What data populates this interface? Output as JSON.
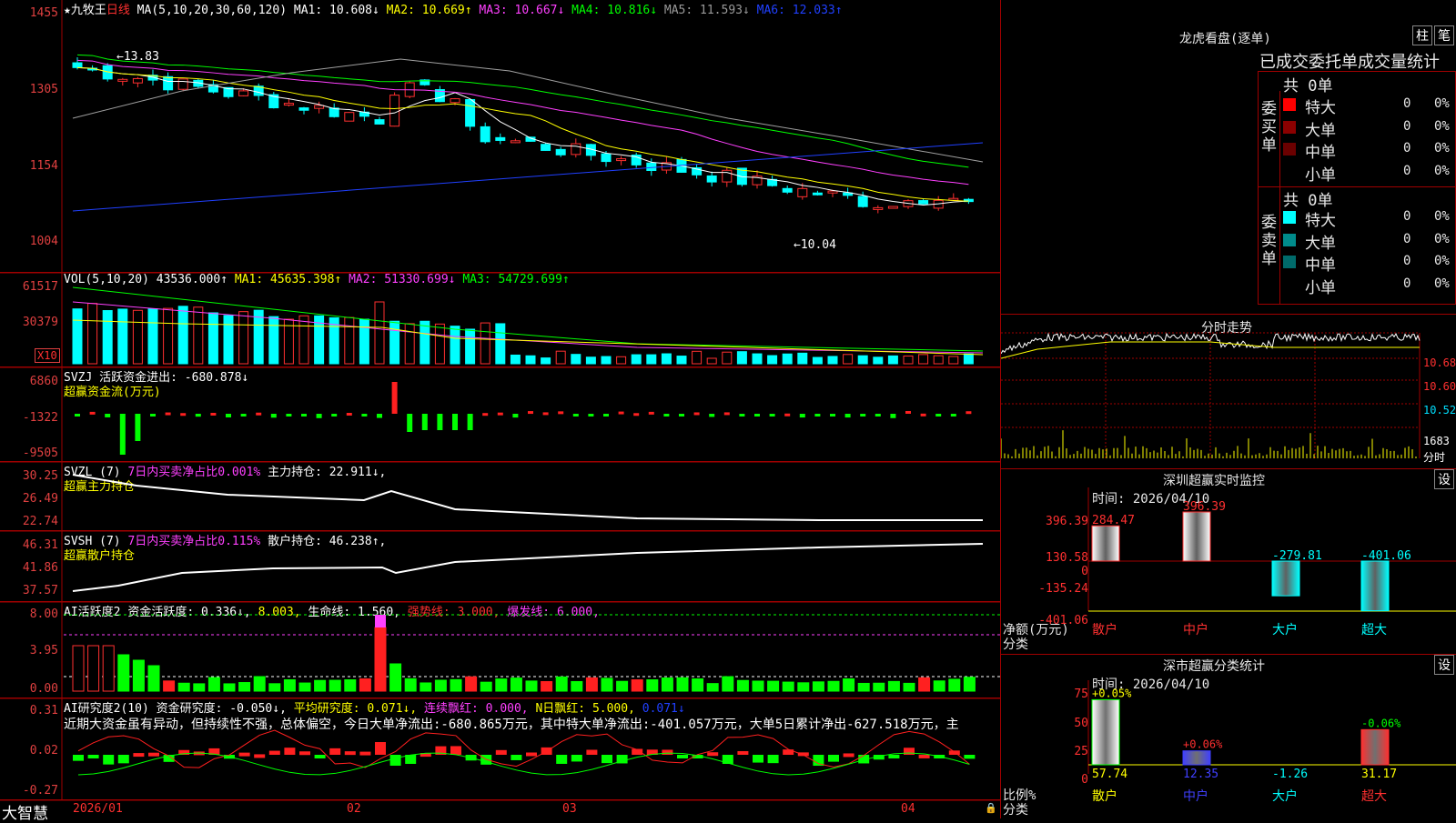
{
  "main": {
    "stock_name": "★九牧王",
    "period": "日线",
    "ma_label": "MA(5,10,20,30,60,120)",
    "ma1": "MA1: 10.608↓",
    "ma2": "MA2: 10.669↑",
    "ma3": "MA3: 10.667↓",
    "ma4": "MA4: 10.816↓",
    "ma5": "MA5: 11.593↓",
    "ma6": "MA6: 12.033↑",
    "y_ticks": [
      "1455",
      "1305",
      "1154",
      "1004"
    ],
    "high_label": "13.83",
    "low_label": "10.04"
  },
  "vol": {
    "label": "VOL(5,10,20)",
    "value": "43536.000↑",
    "ma1": "MA1: 45635.398↑",
    "ma2": "MA2: 51330.699↓",
    "ma3": "MA3: 54729.699↑",
    "y_ticks": [
      "61517",
      "30379"
    ],
    "unit": "X10"
  },
  "svzj": {
    "label": "SVZJ",
    "value": "活跃资金进出: -680.878↓",
    "title": "超赢资金流(万元)",
    "y_ticks": [
      "6860",
      "-1322",
      "-9505"
    ]
  },
  "svzl": {
    "label": "SVZL (7)",
    "ratio": "7日内买卖净占比0.001%",
    "value": "主力持仓: 22.911↓,",
    "title": "超赢主力持仓",
    "y_ticks": [
      "30.25",
      "26.49",
      "22.74"
    ]
  },
  "svsh": {
    "label": "SVSH (7)",
    "ratio": "7日内买卖净占比0.115%",
    "value": "散户持仓: 46.238↑,",
    "title": "超赢散户持仓",
    "y_ticks": [
      "46.31",
      "41.86",
      "37.57"
    ]
  },
  "ai1": {
    "label": "AI活跃度2",
    "v1": "资金活跃度: 0.336↓,",
    "v2": "8.003,",
    "v3": "生命线: 1.560,",
    "v4": "强势线: 3.000,",
    "v5": "爆发线: 6.000,",
    "y_ticks": [
      "8.00",
      "3.95",
      "0.00"
    ]
  },
  "ai2": {
    "label": "AI研究度2(10)",
    "v1": "资金研究度: -0.050↓,",
    "v2": "平均研究度: 0.071↓,",
    "v3": "连续飘红: 0.000,",
    "v4": "N日飘红: 5.000,",
    "v5": "0.071↓",
    "comment": "近期大资金虽有异动，但持续性不强，总体偏空，今日大单净流出:-680.865万元，其中特大单净流出:-401.057万元，大单5日累计净出-627.518万元，主",
    "y_ticks": [
      "0.31",
      "0.02",
      "-0.27"
    ]
  },
  "footer": {
    "brand": "大智慧",
    "dates": [
      "2026/01",
      "02",
      "03",
      "04"
    ]
  },
  "lhb": {
    "title": "龙虎看盘(逐单)",
    "btn1": "柱",
    "btn2": "笔",
    "tabs": "已成交委托单成交量统计",
    "buy_label": "委买单",
    "buy_total": "共 0单",
    "sell_label": "委卖单",
    "sell_total": "共 0单",
    "rows": [
      {
        "name": "特大",
        "count": "0",
        "pct": "0%"
      },
      {
        "name": "大单",
        "count": "0",
        "pct": "0%"
      },
      {
        "name": "中单",
        "count": "0",
        "pct": "0%"
      },
      {
        "name": "小单",
        "count": "0",
        "pct": "0%"
      }
    ],
    "buy_colors": [
      "#ff0000",
      "#8b0000",
      "#6b0000",
      "#000000"
    ],
    "sell_colors": [
      "#00ffff",
      "#008b8b",
      "#006b6b",
      "#000000"
    ]
  },
  "intraday": {
    "title": "分时走势",
    "ticks": [
      "10.68",
      "10.60",
      "10.52",
      "1683",
      "分时"
    ]
  },
  "sz_monitor": {
    "title": "深圳超赢实时监控",
    "btn": "设",
    "time": "时间: 2026/04/10",
    "y_ticks": [
      "396.39",
      "130.58",
      "0",
      "-135.24",
      "-401.06"
    ],
    "unit": "净额(万元)",
    "axis_name": "分类",
    "categories": [
      "散户",
      "中户",
      "大户",
      "超大"
    ],
    "values": [
      284.47,
      396.39,
      -279.81,
      -401.06
    ],
    "value_labels": [
      "284.47",
      "396.39",
      "-279.81",
      "-401.06"
    ]
  },
  "sz_class": {
    "title": "深市超赢分类统计",
    "btn": "设",
    "time": "时间: 2026/04/10",
    "y_ticks": [
      "75",
      "50",
      "25",
      "0"
    ],
    "unit": "比例%",
    "axis_name": "分类",
    "categories": [
      "散户",
      "中户",
      "大户",
      "超大"
    ],
    "values": [
      57.74,
      12.35,
      -1.26,
      31.17
    ],
    "value_labels": [
      "57.74",
      "12.35",
      "-1.26",
      "31.17"
    ],
    "change_labels": [
      "+0.05%",
      "+0.06%",
      "",
      "-0.06%"
    ]
  }
}
